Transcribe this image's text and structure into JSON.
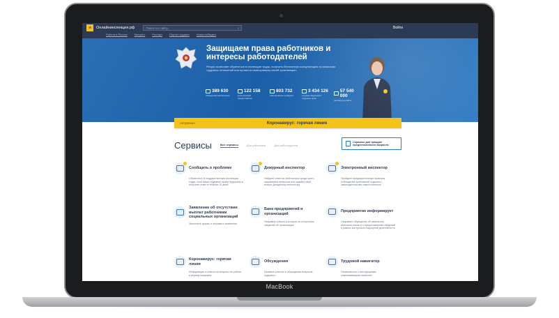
{
  "device": {
    "brand": "MacBook"
  },
  "topbar": {
    "menu_icon": "hamburger-icon",
    "site_name": "Онлайнинспекция.рф",
    "search_placeholder": "Поиск по сайту...",
    "login": "Войти"
  },
  "subnav": [
    "Работа в России",
    "Мигрант",
    "Рестарт",
    "Портал трудяги",
    "Новости/Видео"
  ],
  "hero": {
    "title": "Защищаем права работников и интересы работодателей",
    "subtitle": "Ресурс позволяет обратиться в инспекцию труда, получить бесплатную консультацию по вопросам трудовых отношений или провести самопроверку своей организации.",
    "stats": [
      {
        "value": "389 630",
        "label": "обращений рассмотрено",
        "icon": "people-icon"
      },
      {
        "value": "122 158",
        "label": "консультаций предоставлено",
        "icon": "question-icon"
      },
      {
        "value": "803 732",
        "label": "самопроверок пройдено",
        "icon": "list-icon"
      },
      {
        "value": "3 434 126",
        "label": "случаев нарушения трудовых прав",
        "icon": "shield-icon"
      },
      {
        "value": "57 540 000",
        "label": "просмотров сайта",
        "icon": "eye-icon"
      }
    ]
  },
  "alert": {
    "tag": "Актуально",
    "text": "Коронавирус: горячая линия"
  },
  "services": {
    "title": "Сервисы",
    "tabs": [
      "Все сервисы",
      "Для работника",
      "Для работодателя"
    ],
    "elder_button": "Сервисы для граждан предпенсионного возраста",
    "cards": [
      {
        "title": "Сообщить о проблеме",
        "desc": "Обратитесь в государственную инспекцию труда, если ваши трудовые права нарушены и получите ответ в течение 30 дней",
        "icon": "mail-icon",
        "badge": true
      },
      {
        "title": "Дежурный инспектор",
        "desc": "Найдите ответ на свой вопрос среди часто задаваемых вопросов или задайте свой вопрос Дежурному инспектору",
        "icon": "question-bubble-icon",
        "badge": true
      },
      {
        "title": "Электронный инспектор",
        "desc": "Пройдите предварительную проверку соблюдения требований трудового законодательства самостоятельно",
        "icon": "magnifier-icon",
        "badge": true
      },
      {
        "title": "Заявление об отсутствии выплат работникам социальных организаций",
        "desc": "Заполните форму и отправьте заявление",
        "icon": "card-icon",
        "badge": false
      },
      {
        "title": "Банк предприятий и организаций",
        "desc": "Направьте запрос в которых по получению сведений об организации",
        "icon": "bank-icon",
        "badge": false
      },
      {
        "title": "Предприятие информирует",
        "desc": "Направьте обращение об изменении категории риска и о предоставлении сведений в рамках контрольно-надзорной деятельности",
        "icon": "document-icon",
        "badge": false
      },
      {
        "title": "Коронавирус: горячая линия",
        "desc": "Информация и ответы на вопросы по работе в период пандемии",
        "icon": "virus-icon",
        "badge": false
      },
      {
        "title": "Обсуждения",
        "desc": "Примите участие в обсуждении вопросов трудового",
        "icon": "chat-icon",
        "badge": false
      },
      {
        "title": "Трудовой навигатор",
        "desc": "Ознакомьтесь с инструкциями, охватывающими наиболее",
        "icon": "compass-icon",
        "badge": false
      }
    ]
  },
  "chat_fab": {
    "icon": "chat-bubble-icon"
  }
}
